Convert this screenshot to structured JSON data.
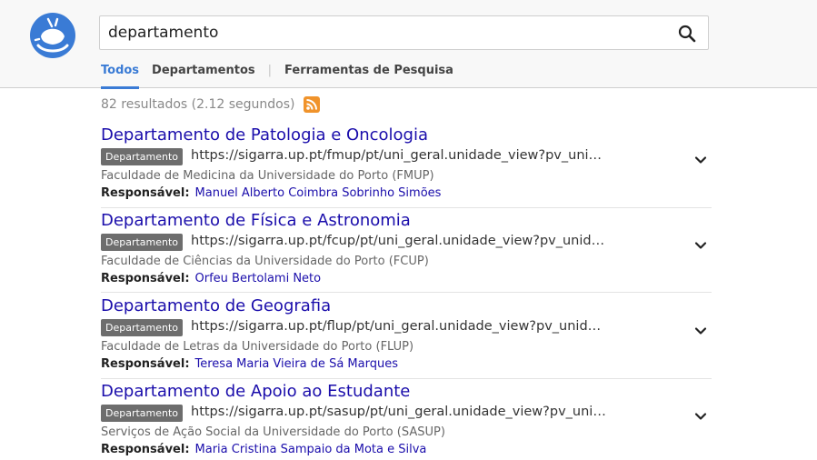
{
  "search": {
    "query": "departamento"
  },
  "tabs": [
    {
      "label": "Todos"
    },
    {
      "label": "Departamentos"
    },
    {
      "label": "Ferramentas de Pesquisa"
    }
  ],
  "stats": {
    "text": "82 resultados (2.12 segundos)"
  },
  "results": [
    {
      "title": "Departamento de Patologia e Oncologia",
      "badge": "Departamento",
      "url": "https://sigarra.up.pt/fmup/pt/uni_geral.unidade_view?pv_unidade=",
      "faculty": "Faculdade de Medicina da Universidade do Porto (FMUP)",
      "resp_label": "Responsável:",
      "resp_name": "Manuel Alberto Coimbra Sobrinho Simões"
    },
    {
      "title": "Departamento de Física e Astronomia",
      "badge": "Departamento",
      "url": "https://sigarra.up.pt/fcup/pt/uni_geral.unidade_view?pv_unidade=",
      "faculty": "Faculdade de Ciências da Universidade do Porto (FCUP)",
      "resp_label": "Responsável:",
      "resp_name": "Orfeu Bertolami Neto"
    },
    {
      "title": "Departamento de Geografia",
      "badge": "Departamento",
      "url": "https://sigarra.up.pt/flup/pt/uni_geral.unidade_view?pv_unidade=",
      "faculty": "Faculdade de Letras da Universidade do Porto (FLUP)",
      "resp_label": "Responsável:",
      "resp_name": "Teresa Maria Vieira de Sá Marques"
    },
    {
      "title": "Departamento de Apoio ao Estudante",
      "badge": "Departamento",
      "url": "https://sigarra.up.pt/sasup/pt/uni_geral.unidade_view?pv_unidade=",
      "faculty": "Serviços de Ação Social da Universidade do Porto (SASUP)",
      "resp_label": "Responsável:",
      "resp_name": "Maria Cristina Sampaio da Mota e Silva"
    }
  ],
  "colors": {
    "accent": "#3a7bd5",
    "link": "#1a0dab",
    "badge": "#6d6d6d",
    "rss": "#f0932b"
  },
  "icons": {
    "logo": "bug-logo-icon",
    "search": "search-icon",
    "rss": "rss-icon",
    "expand": "chevron-down-icon"
  }
}
